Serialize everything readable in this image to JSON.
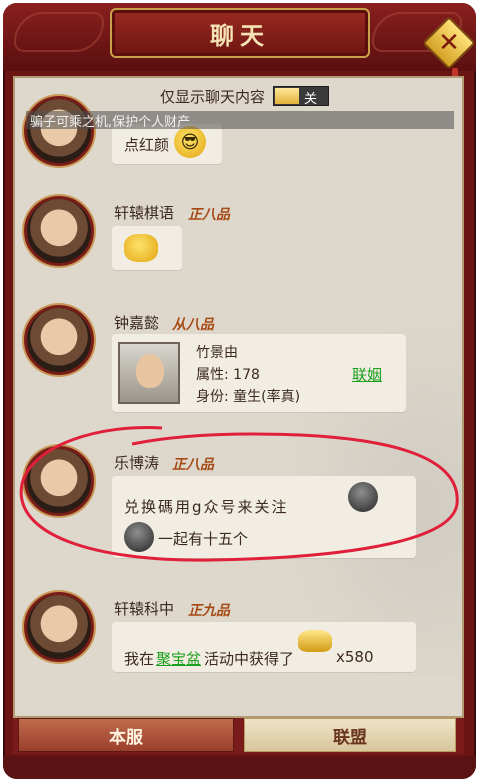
{
  "window": {
    "title": "聊天"
  },
  "toggle": {
    "label": "仅显示聊天内容",
    "state": "关"
  },
  "warning": "骗子可乘之机,保护个人财产",
  "messages": [
    {
      "name": "",
      "rank": "",
      "text": "点红颜",
      "emoji": "sunglasses-emoji"
    },
    {
      "name": "轩辕棋语",
      "rank": "正八品",
      "emoji": "shy-emoji"
    },
    {
      "name": "钟嘉懿",
      "rank": "从八品",
      "card": {
        "name": "竹景由",
        "attr_label": "属性: 178",
        "identity_label": "身份: 童生(率真)",
        "action": "联姻"
      }
    },
    {
      "name": "乐博涛",
      "rank": "正八品",
      "line1": "兑换碼用g众号来关注",
      "line2": "一起有十五个"
    },
    {
      "name": "轩辕科中",
      "rank": "正九品",
      "prefix": "我在",
      "link": "聚宝盆",
      "suffix": "活动中获得了",
      "quantity": "x580"
    }
  ],
  "tabs": [
    {
      "label": "本服",
      "active": true
    },
    {
      "label": "联盟",
      "active": false
    }
  ],
  "colors": {
    "frame": "#6b1414",
    "panel": "#ded8cc",
    "rank": "#a54a14",
    "link": "#19a01c",
    "annotation": "#e0203a"
  }
}
